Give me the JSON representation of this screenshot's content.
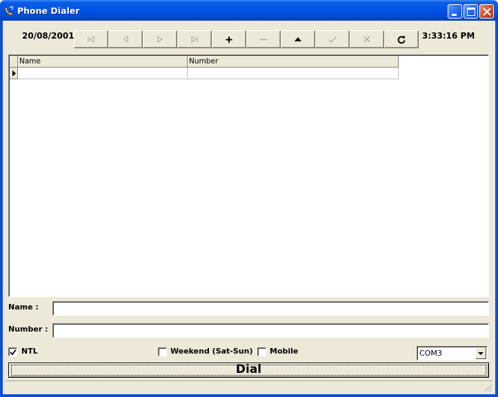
{
  "window": {
    "title": "Phone Dialer",
    "icon": "phone-app-icon",
    "controls": [
      "minimize-icon",
      "maximize-icon",
      "close-icon"
    ],
    "title_color": "#0055e5"
  },
  "toolbar": {
    "date": "20/08/2001",
    "time": "3:33:16 PM",
    "nav_buttons": [
      {
        "name": "first-record-button",
        "icon": "first-icon",
        "enabled": false
      },
      {
        "name": "prior-record-button",
        "icon": "prior-icon",
        "enabled": false
      },
      {
        "name": "next-record-button",
        "icon": "next-icon",
        "enabled": false
      },
      {
        "name": "last-record-button",
        "icon": "last-icon",
        "enabled": false
      },
      {
        "name": "insert-record-button",
        "icon": "plus-icon",
        "enabled": true
      },
      {
        "name": "delete-record-button",
        "icon": "minus-icon",
        "enabled": false
      },
      {
        "name": "edit-record-button",
        "icon": "up-triangle-icon",
        "enabled": true
      },
      {
        "name": "post-record-button",
        "icon": "checkmark-icon",
        "enabled": false
      },
      {
        "name": "cancel-record-button",
        "icon": "x-icon",
        "enabled": false
      },
      {
        "name": "refresh-button",
        "icon": "refresh-icon",
        "enabled": true
      }
    ]
  },
  "grid": {
    "columns": [
      "Name",
      "Number"
    ],
    "rows": [
      [
        "",
        ""
      ]
    ]
  },
  "form": {
    "name_label": "Name :",
    "name_value": "",
    "number_label": "Number :",
    "number_value": ""
  },
  "options": {
    "ntl_label": "NTL",
    "ntl_checked": true,
    "weekend_label": "Weekend (Sat-Sun)",
    "weekend_checked": false,
    "mobile_label": "Mobile",
    "mobile_checked": false,
    "port_selected": "COM3"
  },
  "dial_label": "Dial"
}
